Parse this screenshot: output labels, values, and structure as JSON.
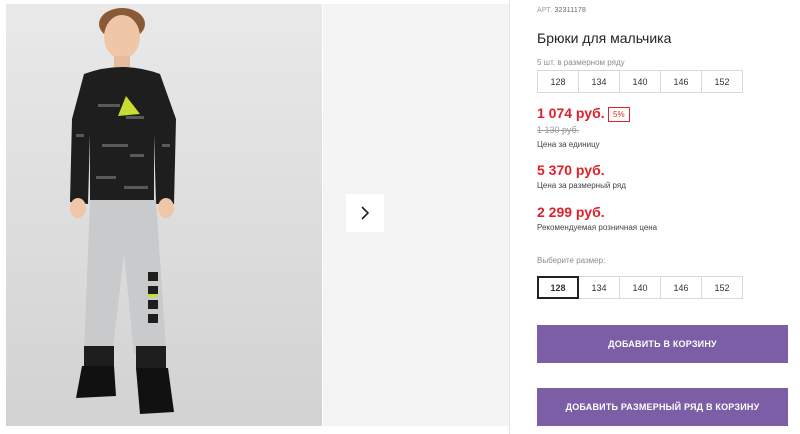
{
  "product": {
    "article_label": "АРТ.",
    "article": "32311178",
    "title": "Брюки для мальчика",
    "pack_hint": "5 шт. в размерном ряду"
  },
  "pack_sizes": [
    "128",
    "134",
    "140",
    "146",
    "152"
  ],
  "pricing": {
    "unit_price": "1 074 руб.",
    "discount": "5%",
    "old_price": "1 130 руб.",
    "unit_caption": "Цена за единицу",
    "set_price": "5 370 руб.",
    "set_caption": "Цена за размерный ряд",
    "rrp_price": "2 299 руб.",
    "rrp_caption": "Рекомендуемая розничная цена"
  },
  "size_selector": {
    "label": "Выберите размер:",
    "options": [
      "128",
      "134",
      "140",
      "146",
      "152"
    ],
    "selected": "128"
  },
  "buttons": {
    "add_to_cart": "ДОБАВИТЬ В КОРЗИНУ",
    "add_set_to_cart": "ДОБАВИТЬ РАЗМЕРНЫЙ РЯД В КОРЗИНУ"
  },
  "gallery": {
    "next_icon": "chevron-right-icon"
  },
  "colors": {
    "accent": "#7b5ea6",
    "price": "#e0202a"
  }
}
